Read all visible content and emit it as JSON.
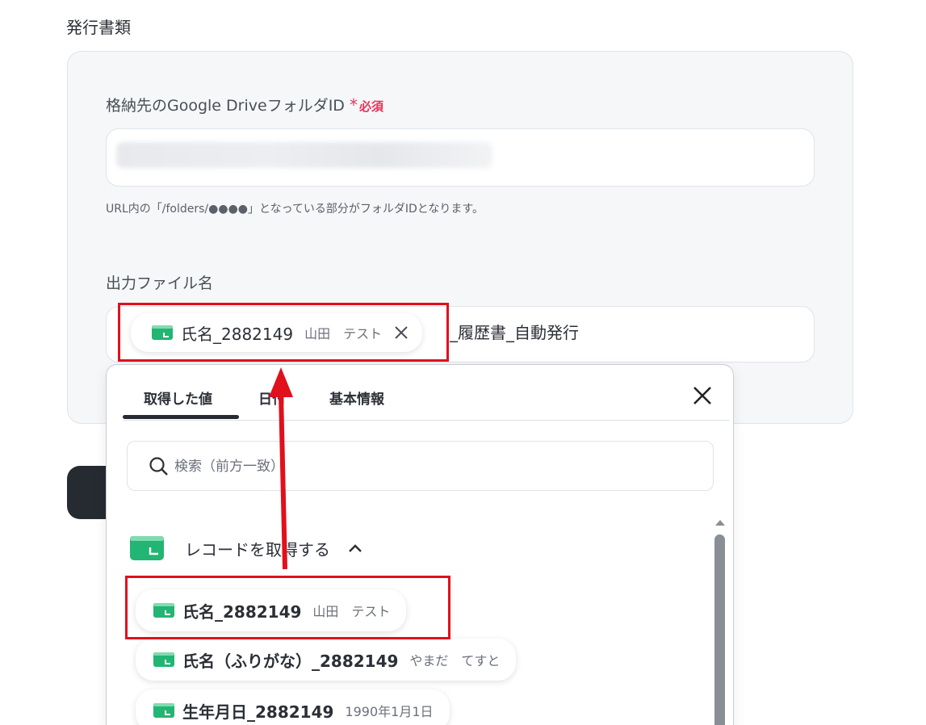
{
  "section": {
    "title": "発行書類"
  },
  "folder_field": {
    "label": "格納先のGoogle DriveフォルダID",
    "required_star": "*",
    "required_text": "必須",
    "value": "",
    "helper": "URL内の「/folders/●●●●」となっている部分がフォルダIDとなります。"
  },
  "filename_field": {
    "label": "出力ファイル名",
    "chip": {
      "name": "氏名_2882149",
      "value": "山田　テスト"
    },
    "suffix": "_履歴書_自動発行"
  },
  "panel": {
    "tabs": [
      {
        "label": "取得した値"
      },
      {
        "label": "日付"
      },
      {
        "label": "基本情報"
      }
    ],
    "search_placeholder": "検索（前方一致）",
    "group": {
      "title": "レコードを取得する"
    },
    "items": [
      {
        "name": "氏名_2882149",
        "value": "山田　テスト"
      },
      {
        "name": "氏名（ふりがな）_2882149",
        "value": "やまだ　てすと"
      },
      {
        "name": "生年月日_2882149",
        "value": "1990年1月1日"
      }
    ]
  },
  "colors": {
    "accent_required": "#e5335a",
    "chip_icon_green": "#22b573",
    "annotation_red": "#e0101c",
    "dark_button": "#262a31"
  },
  "icons": [
    "record-chip-icon",
    "close-icon",
    "search-icon",
    "chevron-up-icon",
    "scroll-up-icon"
  ]
}
